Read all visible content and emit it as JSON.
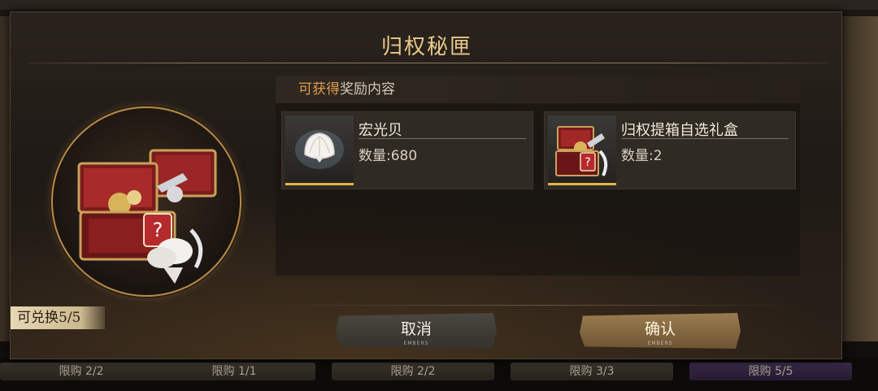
{
  "dialog": {
    "title": "归权秘匣",
    "redeem_badge": "可兑换5/5",
    "reward_header": {
      "highlight": "可获得",
      "rest": "奖励内容"
    },
    "rewards": [
      {
        "name": "宏光贝",
        "qty": "数量:680",
        "icon": "pearl-shell-icon"
      },
      {
        "name": "归权提箱自选礼盒",
        "qty": "数量:2",
        "icon": "treasure-chest-icon"
      }
    ],
    "buttons": {
      "cancel": "取消",
      "confirm": "确认",
      "sub": "EMBERS"
    }
  },
  "shop_tabs": [
    "限购 2/2",
    "限购 1/1",
    "限购 2/2",
    "限购 3/3",
    "限购 5/5"
  ],
  "colors": {
    "title_gold": "#e9c98a",
    "highlight_orange": "#e09a4e",
    "rarity_gold": "#e2b540",
    "confirm_button": "#9a7c50",
    "cancel_button": "#4a4740"
  }
}
